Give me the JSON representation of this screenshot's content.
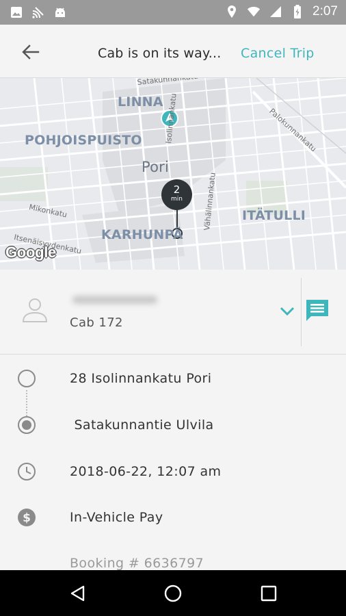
{
  "status_bar": {
    "time": "2:07",
    "left_icons": [
      "image-icon",
      "cast-icon",
      "android-icon"
    ],
    "right_icons": [
      "location-icon",
      "wifi-icon",
      "signal-icon",
      "battery-charging-icon"
    ]
  },
  "app_bar": {
    "back_icon": "arrow-back-icon",
    "title": "Cab is on its way...",
    "cancel_label": "Cancel Trip",
    "accent_color": "#3fb6bc"
  },
  "map": {
    "areas": [
      "LINNA",
      "POHJOISPUISTO",
      "Pori",
      "KARHUNPÄ",
      "ITÄTULLI"
    ],
    "streets": [
      "Isolinnankatu",
      "Vähälinnankatu",
      "Itsenäisyydenkatu",
      "Mikonkatu",
      "Palokunnankatu",
      "Satakunnankatu"
    ],
    "eta_value": "2",
    "eta_unit": "min",
    "attribution": "Google"
  },
  "driver": {
    "vehicle": "Cab 172"
  },
  "trip": {
    "pickup": "28 Isolinnankatu Pori",
    "dropoff": " Satakunnantie Ulvila",
    "datetime": "2018-06-22, 12:07 am",
    "payment": "In-Vehicle Pay",
    "booking": "Booking # 6636797"
  },
  "nav_bar": {
    "icons": [
      "back-triangle-icon",
      "home-circle-icon",
      "recents-square-icon"
    ]
  }
}
